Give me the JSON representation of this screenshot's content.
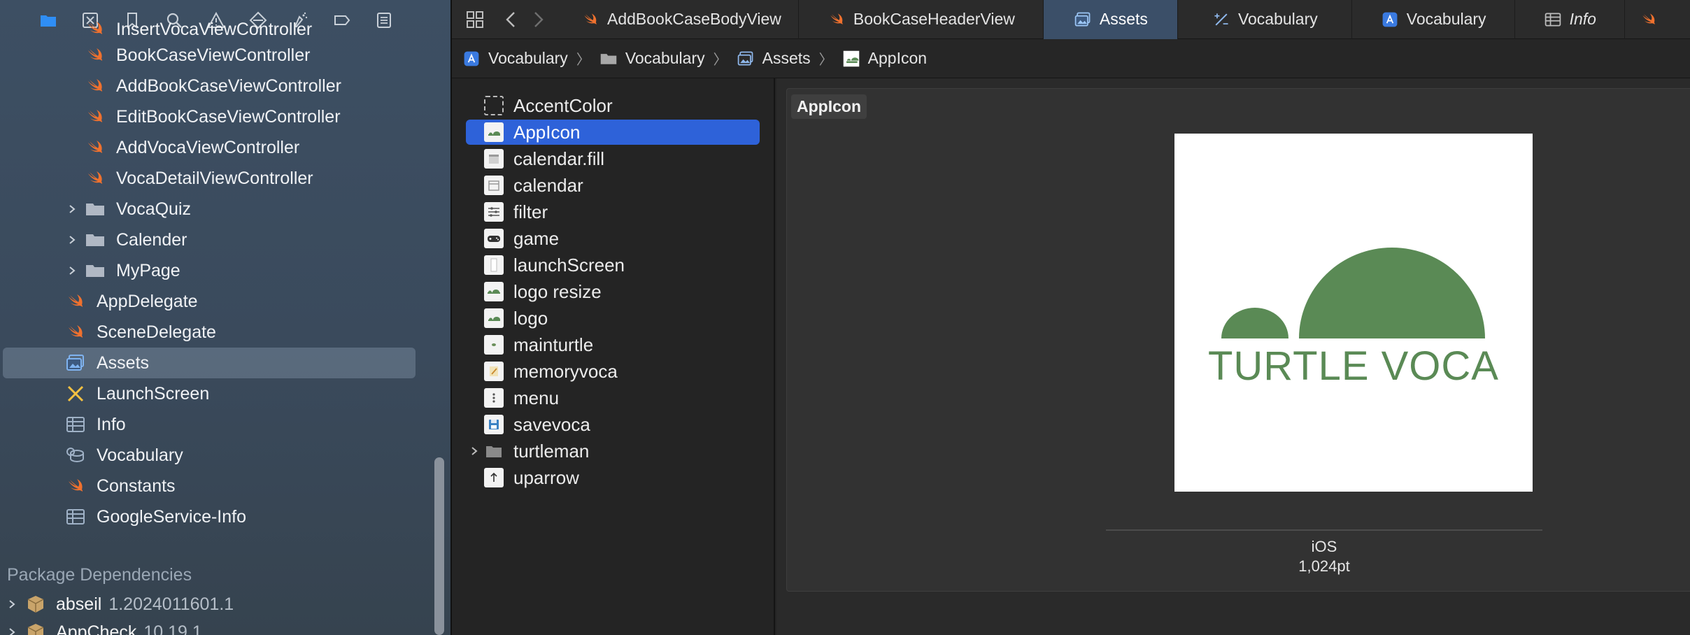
{
  "navigator": {
    "toolbar_icons": [
      "folder-icon",
      "source-control-icon",
      "bookmark-icon",
      "find-icon",
      "issue-icon",
      "test-icon",
      "debug-icon",
      "breakpoint-icon",
      "report-icon"
    ],
    "items": [
      {
        "label": "InsertVocaViewController",
        "icon": "swift-icon"
      },
      {
        "label": "BookCaseViewController",
        "icon": "swift-icon"
      },
      {
        "label": "AddBookCaseViewController",
        "icon": "swift-icon"
      },
      {
        "label": "EditBookCaseViewController",
        "icon": "swift-icon"
      },
      {
        "label": "AddVocaViewController",
        "icon": "swift-icon"
      },
      {
        "label": "VocaDetailViewController",
        "icon": "swift-icon"
      },
      {
        "label": "VocaQuiz",
        "icon": "folder-icon"
      },
      {
        "label": "Calender",
        "icon": "folder-icon"
      },
      {
        "label": "MyPage",
        "icon": "folder-icon"
      },
      {
        "label": "AppDelegate",
        "icon": "swift-icon"
      },
      {
        "label": "SceneDelegate",
        "icon": "swift-icon"
      },
      {
        "label": "Assets",
        "icon": "asset-catalog-icon"
      },
      {
        "label": "LaunchScreen",
        "icon": "storyboard-icon"
      },
      {
        "label": "Info",
        "icon": "plist-icon"
      },
      {
        "label": "Vocabulary",
        "icon": "coredata-icon"
      },
      {
        "label": "Constants",
        "icon": "swift-icon"
      },
      {
        "label": "GoogleService-Info",
        "icon": "plist-icon"
      }
    ],
    "package_header": "Package Dependencies",
    "packages": [
      {
        "name": "abseil",
        "version": "1.2024011601.1"
      },
      {
        "name": "AppCheck",
        "version": "10.19.1"
      }
    ]
  },
  "tabs": [
    {
      "label": "AddBookCaseBodyView",
      "icon": "swift-icon"
    },
    {
      "label": "BookCaseHeaderView",
      "icon": "swift-icon"
    },
    {
      "label": "Assets",
      "icon": "asset-catalog-icon"
    },
    {
      "label": "Vocabulary",
      "icon": "build-settings-icon"
    },
    {
      "label": "Vocabulary",
      "icon": "app-target-icon"
    },
    {
      "label": "Info",
      "icon": "plist-icon"
    }
  ],
  "breadcrumb": [
    {
      "label": "Vocabulary",
      "icon": "app-target-icon"
    },
    {
      "label": "Vocabulary",
      "icon": "folder-icon"
    },
    {
      "label": "Assets",
      "icon": "asset-catalog-icon"
    },
    {
      "label": "AppIcon",
      "icon": "appicon-thumb-icon"
    }
  ],
  "assets": [
    {
      "label": "AccentColor"
    },
    {
      "label": "AppIcon"
    },
    {
      "label": "calendar.fill"
    },
    {
      "label": "calendar"
    },
    {
      "label": "filter"
    },
    {
      "label": "game"
    },
    {
      "label": "launchScreen"
    },
    {
      "label": "logo resize"
    },
    {
      "label": "logo"
    },
    {
      "label": "mainturtle"
    },
    {
      "label": "memoryvoca"
    },
    {
      "label": "menu"
    },
    {
      "label": "savevoca"
    },
    {
      "label": "turtleman"
    },
    {
      "label": "uparrow"
    }
  ],
  "detail": {
    "set_name": "AppIcon",
    "logo_text": "TURTLE VOCA",
    "platform": "iOS",
    "size": "1,024pt"
  },
  "colors": {
    "swift": "#f0712e",
    "folder": "#b0b8c4",
    "accent": "#2e62d9",
    "logo_green": "#5a8a55"
  }
}
